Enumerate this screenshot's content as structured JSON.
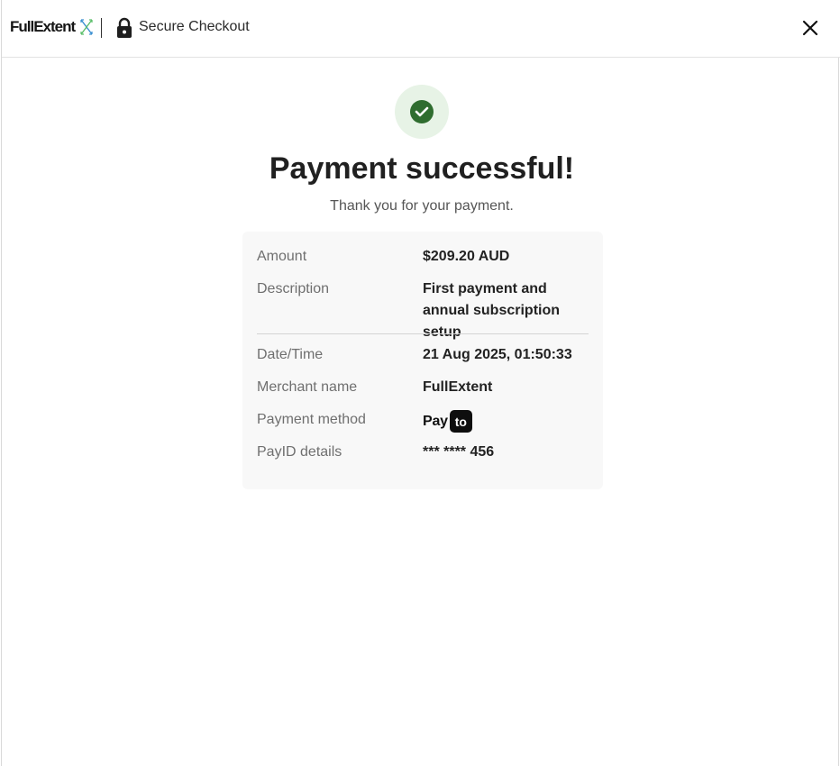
{
  "header": {
    "brand": "FullExtent",
    "secure_label": "Secure Checkout"
  },
  "status": {
    "title": "Payment successful!",
    "subtitle": "Thank you for your payment."
  },
  "details": {
    "amount": {
      "label": "Amount",
      "value": "$209.20 AUD"
    },
    "description": {
      "label": "Description",
      "value": "First payment and annual subscription setup"
    },
    "datetime": {
      "label": "Date/Time",
      "value": "21 Aug 2025, 01:50:33"
    },
    "merchant": {
      "label": "Merchant name",
      "value": "FullExtent"
    },
    "method": {
      "label": "Payment method",
      "logo_pay": "Pay",
      "logo_to": "to"
    },
    "payid": {
      "label": "PayID details",
      "value": "*** **** 456"
    }
  },
  "colors": {
    "success_green": "#2f6d2f",
    "success_bg": "#e7f3e6",
    "card_bg": "#f8f8f8"
  },
  "icons": {
    "lock": "lock-icon",
    "close": "close-icon",
    "check": "check-circle-icon",
    "brand_mark": "fullextent-logo-mark"
  }
}
